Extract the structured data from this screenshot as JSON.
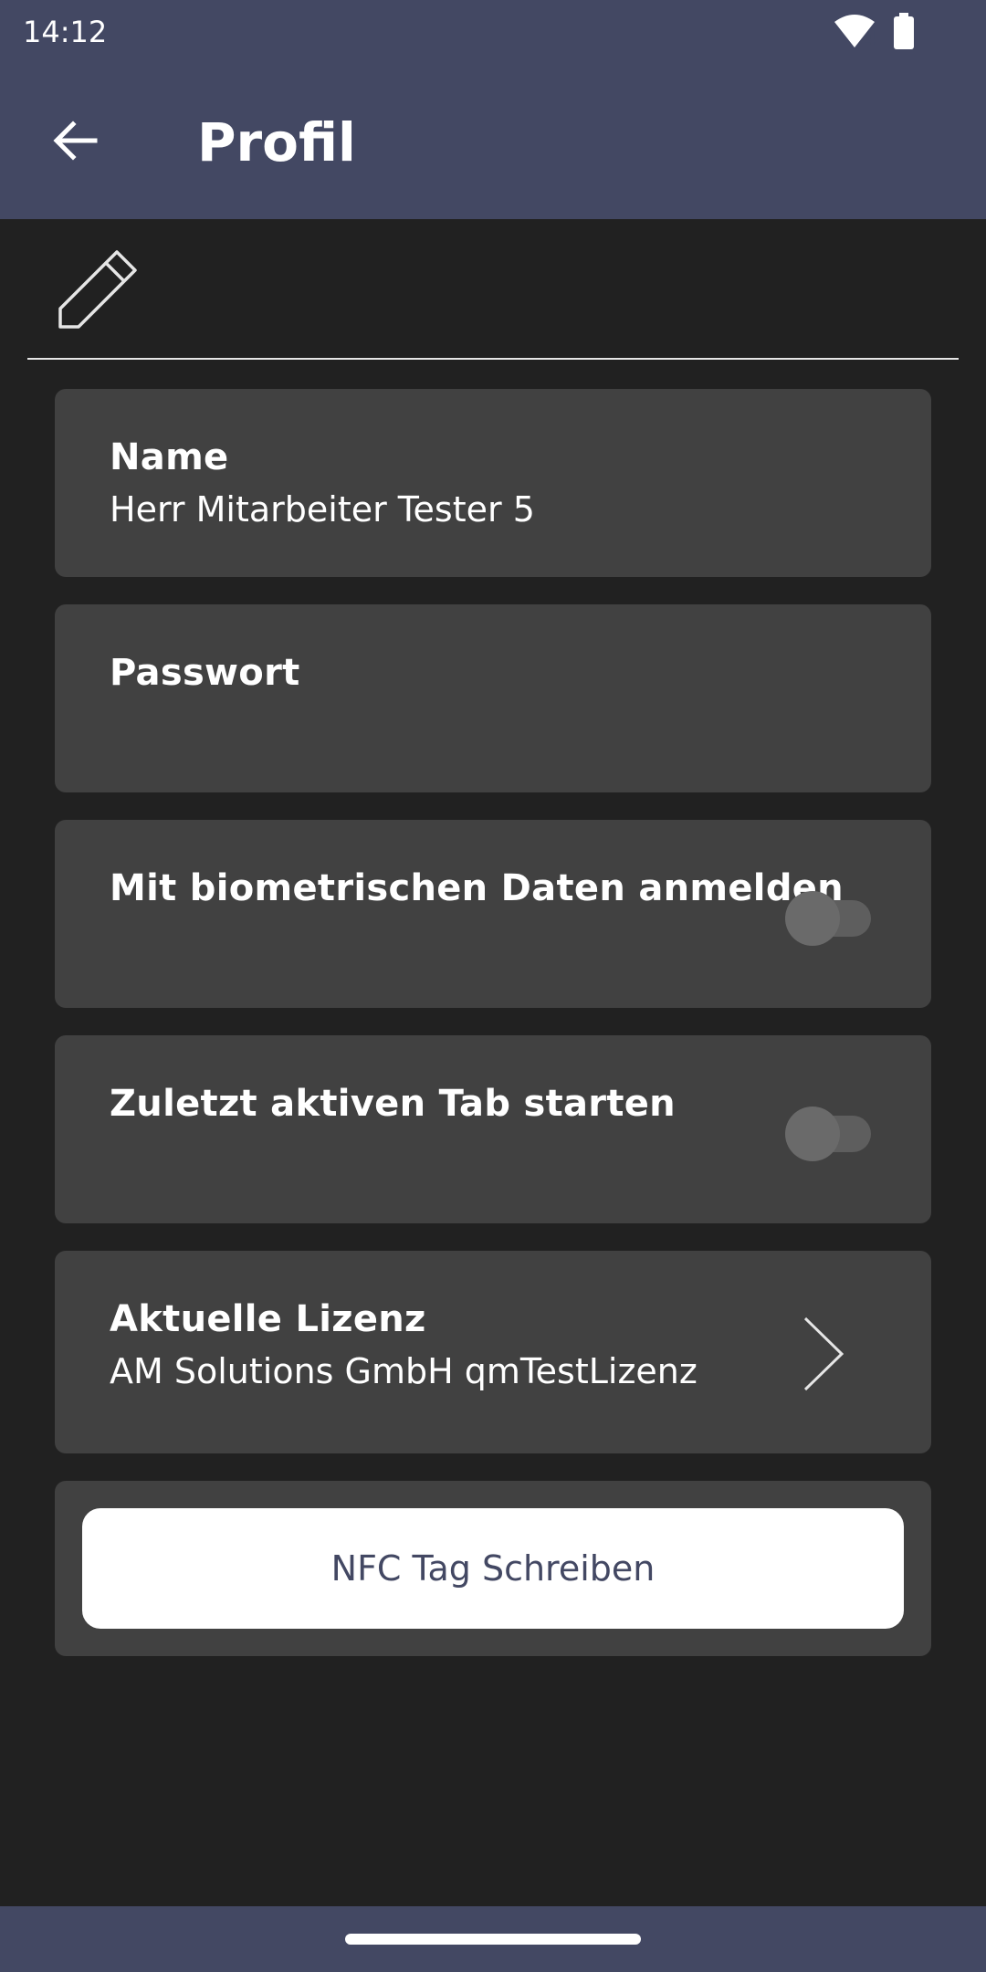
{
  "status_bar": {
    "time": "14:12",
    "wifi_icon": "wifi-icon",
    "battery_icon": "battery-icon",
    "wifi_badge": "4"
  },
  "app_bar": {
    "title": "Profil",
    "back_icon": "arrow-back-icon"
  },
  "toolbar": {
    "edit_icon": "pencil-icon"
  },
  "profile": {
    "name_label": "Name",
    "name_value": "Herr Mitarbeiter Tester 5",
    "password_label": "Passwort",
    "biometric_label": "Mit biometrischen Daten anmelden",
    "biometric_enabled": false,
    "last_tab_label": "Zuletzt aktiven Tab starten",
    "last_tab_enabled": false,
    "license_label": "Aktuelle Lizenz",
    "license_value": "AM Solutions GmbH qmTestLizenz",
    "license_icon": "chevron-right-icon"
  },
  "actions": {
    "nfc_button_label": "NFC Tag Schreiben"
  },
  "colors": {
    "app_bar": "#434863",
    "background": "#212121",
    "card": "#414141",
    "button": "#ffffff",
    "button_text": "#434863"
  }
}
